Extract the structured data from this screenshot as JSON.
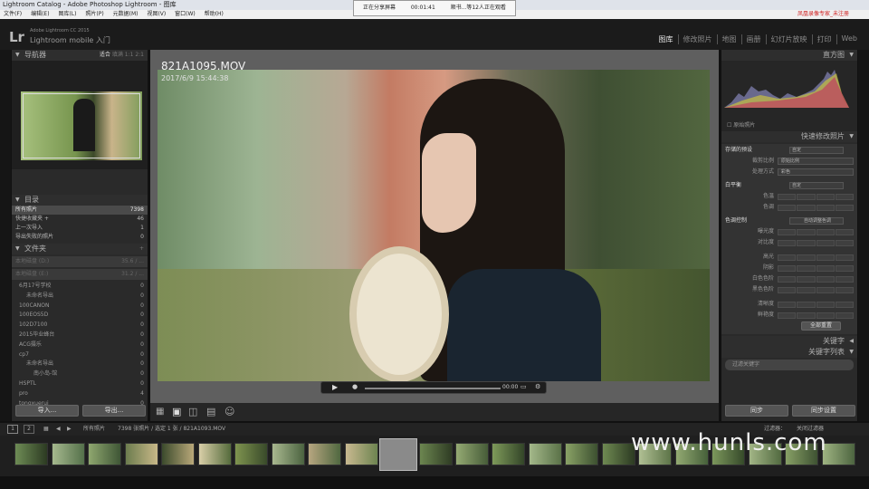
{
  "window_title": "Lightroom Catalog - Adobe Photoshop Lightroom - 图库",
  "menu": [
    "文件(F)",
    "编辑(E)",
    "图库(L)",
    "照片(P)",
    "元数据(M)",
    "视图(V)",
    "窗口(W)",
    "帮助(H)"
  ],
  "menu_brand": "凤凰录像专家_未注册",
  "share": {
    "status": "正在分享屏幕",
    "time": "00:01:41",
    "viewers": "顺书...等12人正在观看"
  },
  "identity": {
    "small": "Adobe Lightroom CC 2015",
    "mobile": "Lightroom mobile 入门"
  },
  "modules": [
    "图库",
    "修改照片",
    "地图",
    "画册",
    "幻灯片放映",
    "打印",
    "Web"
  ],
  "navigator": {
    "title": "导航器",
    "zoom": [
      "适合",
      "填满",
      "1:1",
      "2:1"
    ]
  },
  "catalog": {
    "title": "目录",
    "items": [
      {
        "label": "所有照片",
        "count": "7398"
      },
      {
        "label": "快捷收藏夹 +",
        "count": "46"
      },
      {
        "label": "上一次导入",
        "count": "1"
      },
      {
        "label": "导出失败的照片",
        "count": "0"
      }
    ]
  },
  "folders": {
    "title": "文件夹",
    "volumes": [
      {
        "label": "本地磁盘 (D:)",
        "size": "35.6 / ..."
      },
      {
        "label": "本地磁盘 (E:)",
        "size": "31.2 / ..."
      }
    ],
    "items": [
      {
        "label": "6月17号学校",
        "count": "0"
      },
      {
        "label": "未命名导出",
        "count": "0"
      },
      {
        "label": "100CANON",
        "count": "0"
      },
      {
        "label": "100EOS5D",
        "count": "0"
      },
      {
        "label": "102D7100",
        "count": "0"
      },
      {
        "label": "2015毕业蜂台",
        "count": "0"
      },
      {
        "label": "ACG摄乐",
        "count": "0"
      },
      {
        "label": "cp7",
        "count": "0"
      },
      {
        "label": "未命名导出",
        "count": "0"
      },
      {
        "label": "南小岛-馆",
        "count": "0"
      },
      {
        "label": "HSPTL",
        "count": "0"
      },
      {
        "label": "pro",
        "count": "4"
      },
      {
        "label": "tongxuerui",
        "count": "0"
      }
    ]
  },
  "buttons": {
    "import": "导入...",
    "export": "导出...",
    "sync": "同步",
    "sync_settings": "同步设置"
  },
  "photo": {
    "filename": "821A1095.MOV",
    "date": "2017/6/9 15:44:38"
  },
  "video": {
    "time": "00:00"
  },
  "histogram": {
    "title": "直方图",
    "original": "原始照片"
  },
  "quick_develop": {
    "title": "快速修改照片",
    "saved_preset": {
      "label": "存储的预设",
      "value": "自定"
    },
    "crop": {
      "label": "裁剪比例",
      "value": "原始比例"
    },
    "treatment": {
      "label": "处理方式",
      "value": "彩色"
    },
    "white_balance": {
      "label": "白平衡",
      "value": "自定"
    },
    "wb_sliders": [
      "色温",
      "色调"
    ],
    "tone": {
      "label": "色调控制",
      "auto": "自动调整色调"
    },
    "tone_sliders": [
      "曝光度",
      "对比度",
      "高光",
      "阴影",
      "白色色阶",
      "黑色色阶",
      "清晰度",
      "鲜艳度"
    ],
    "reset": "全部重置"
  },
  "keywords": {
    "title": "关键字",
    "list_title": "关键字列表",
    "filter_placeholder": "过滤关键字"
  },
  "filmstrip": {
    "source": "所有照片",
    "info": "7398 张照片 / 选定 1 张 / 821A1093.MOV",
    "filter": "过滤器：",
    "filter_value": "关闭过滤器",
    "pages": [
      "1",
      "2"
    ]
  },
  "watermark": "www.hunls.com"
}
